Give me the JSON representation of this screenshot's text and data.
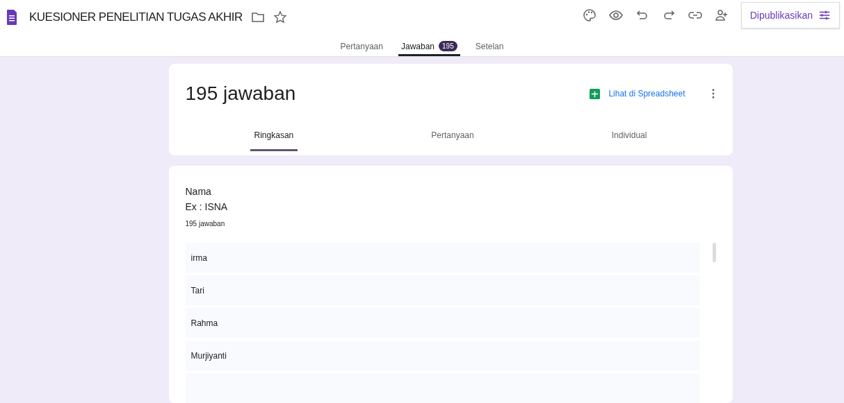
{
  "form_title": "KUESIONER PENELITIAN TUGAS AKHIR",
  "publish_button": "Dipublikasikan",
  "main_tabs": [
    {
      "label": "Pertanyaan",
      "selected": false
    },
    {
      "label": "Jawaban",
      "selected": true,
      "badge": "195"
    },
    {
      "label": "Setelan",
      "selected": false
    }
  ],
  "summary": {
    "title": "195 jawaban",
    "sheet_link": "Lihat di Spreadsheet"
  },
  "sub_tabs": [
    {
      "label": "Ringkasan",
      "selected": true
    },
    {
      "label": "Pertanyaan",
      "selected": false
    },
    {
      "label": "Individual",
      "selected": false
    }
  ],
  "question": {
    "title": "Nama",
    "description": "Ex : ISNA",
    "count": "195 jawaban",
    "answers": [
      "irma",
      "Tari",
      "Rahma",
      "Murjiyanti"
    ]
  }
}
